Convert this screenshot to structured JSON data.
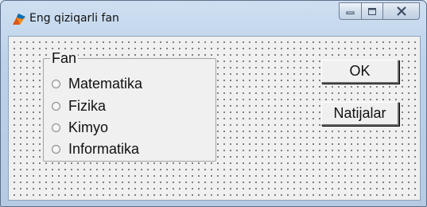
{
  "window": {
    "title": "Eng qiziqarli fan",
    "controls": {
      "minimize_icon": "minimize-icon",
      "maximize_icon": "maximize-icon",
      "close_icon": "close-icon"
    }
  },
  "group": {
    "label": "Fan",
    "options": [
      {
        "label": "Matematika",
        "checked": false
      },
      {
        "label": "Fizika",
        "checked": false
      },
      {
        "label": "Kimyo",
        "checked": false
      },
      {
        "label": "Informatika",
        "checked": false
      }
    ]
  },
  "buttons": {
    "ok": "OK",
    "results": "Natijalar"
  },
  "colors": {
    "titlebar": "#bcd2ea",
    "client_background": "#f0f0f0",
    "grid_dot": "#1a1a1a"
  }
}
